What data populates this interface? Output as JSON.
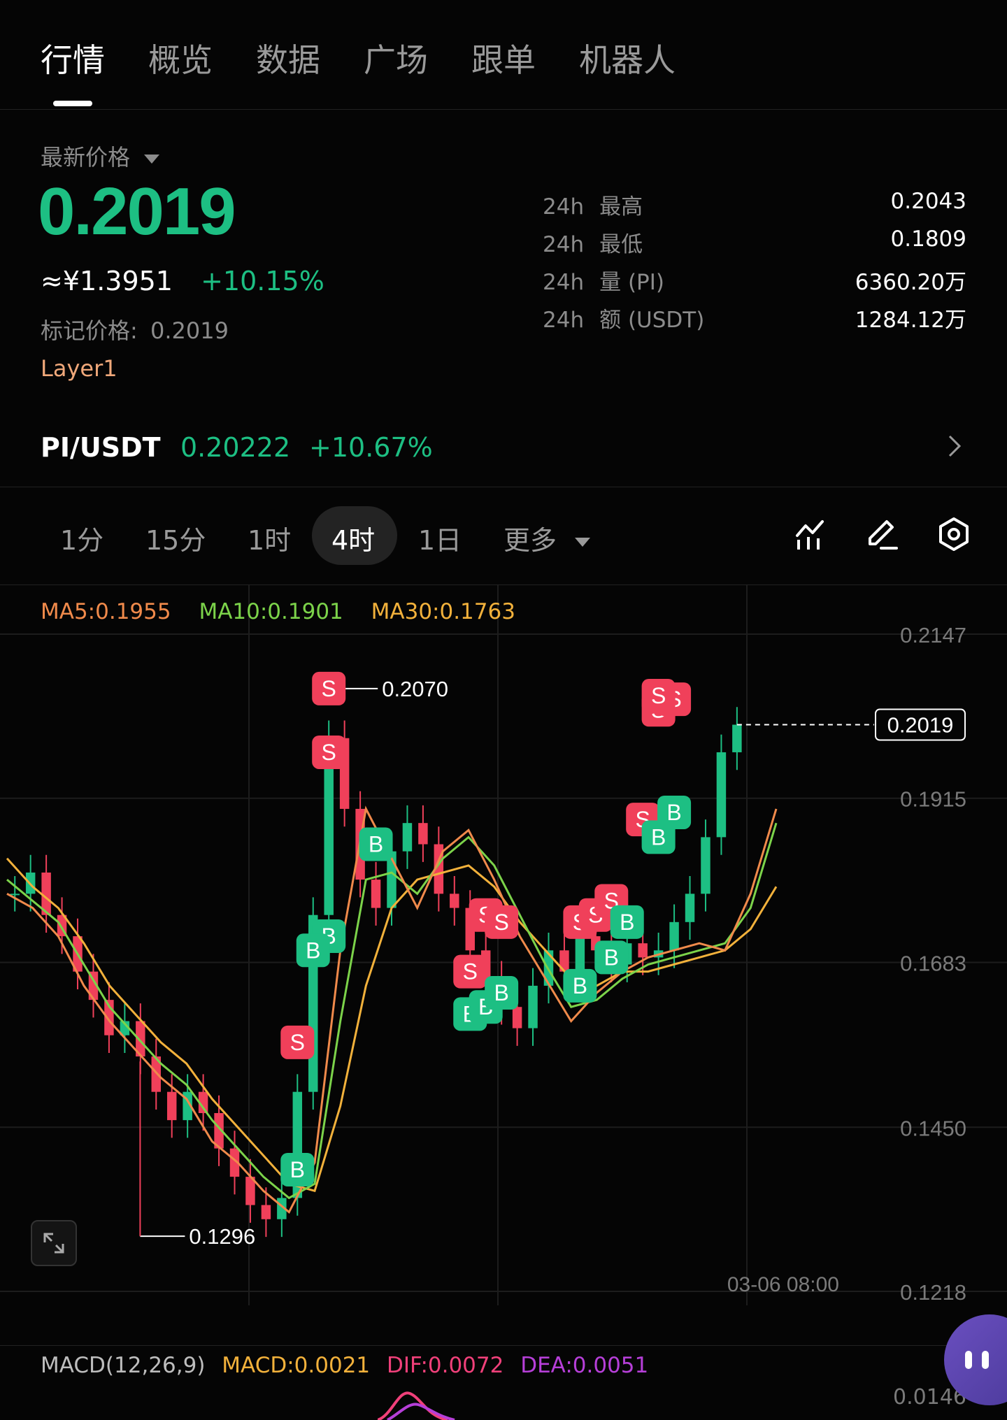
{
  "tabs": [
    {
      "label": "行情",
      "active": true
    },
    {
      "label": "概览"
    },
    {
      "label": "数据"
    },
    {
      "label": "广场"
    },
    {
      "label": "跟单"
    },
    {
      "label": "机器人"
    }
  ],
  "price": {
    "selector_label": "最新价格",
    "last": "0.2019",
    "cny": "≈¥1.3951",
    "change": "+10.15%",
    "mark_label": "标记价格:",
    "mark_value": "0.2019",
    "tag": "Layer1",
    "colors": {
      "up": "#1dbf83",
      "tag": "#f0a87a"
    }
  },
  "stats": [
    {
      "period": "24h",
      "label": "最高",
      "value": "0.2043"
    },
    {
      "period": "24h",
      "label": "最低",
      "value": "0.1809"
    },
    {
      "period": "24h",
      "label": "量 (PI)",
      "value": "6360.20万"
    },
    {
      "period": "24h",
      "label": "额 (USDT)",
      "value": "1284.12万"
    }
  ],
  "pair": {
    "name": "PI/USDT",
    "price": "0.20222",
    "change": "+10.67%"
  },
  "timeframes": {
    "items": [
      "1分",
      "15分",
      "1时",
      "4时",
      "1日"
    ],
    "more": "更多",
    "active": "4时"
  },
  "toolbar_icons": [
    "indicator-icon",
    "pen-icon",
    "settings-icon"
  ],
  "indicators": {
    "ma5": "MA5:0.1955",
    "ma10": "MA10:0.1901",
    "ma30": "MA30:0.1763",
    "colors": {
      "ma5": "#f08a4b",
      "ma10": "#7cd34a",
      "ma30": "#f2b13b"
    }
  },
  "chart_data": {
    "type": "candlestick",
    "y_ticks": [
      "0.2147",
      "0.1915",
      "0.1683",
      "0.1450",
      "0.1218"
    ],
    "ylim": [
      0.1218,
      0.2147
    ],
    "high_label": "0.2070",
    "low_label": "0.1296",
    "current_price_label": "0.2019",
    "x_label": "03-06 08:00",
    "ma5": [
      0.178,
      0.176,
      0.172,
      0.165,
      0.16,
      0.156,
      0.152,
      0.149,
      0.143,
      0.14,
      0.136,
      0.133,
      0.14,
      0.17,
      0.19,
      0.183,
      0.176,
      0.184,
      0.187,
      0.18,
      0.172,
      0.166,
      0.16,
      0.164,
      0.167,
      0.169,
      0.17,
      0.171,
      0.17,
      0.178,
      0.19
    ],
    "ma10": [
      0.18,
      0.177,
      0.174,
      0.168,
      0.162,
      0.158,
      0.154,
      0.151,
      0.146,
      0.142,
      0.138,
      0.135,
      0.137,
      0.16,
      0.18,
      0.181,
      0.178,
      0.183,
      0.186,
      0.182,
      0.175,
      0.168,
      0.162,
      0.163,
      0.166,
      0.168,
      0.169,
      0.17,
      0.171,
      0.176,
      0.188
    ],
    "ma30": [
      0.183,
      0.179,
      0.176,
      0.171,
      0.165,
      0.161,
      0.157,
      0.154,
      0.149,
      0.145,
      0.141,
      0.137,
      0.136,
      0.148,
      0.165,
      0.176,
      0.18,
      0.181,
      0.182,
      0.179,
      0.174,
      0.17,
      0.166,
      0.165,
      0.167,
      0.167,
      0.168,
      0.169,
      0.17,
      0.173,
      0.179
    ],
    "closes": [
      0.178,
      0.181,
      0.175,
      0.172,
      0.167,
      0.163,
      0.158,
      0.16,
      0.155,
      0.15,
      0.146,
      0.15,
      0.147,
      0.142,
      0.138,
      0.134,
      0.132,
      0.135,
      0.15,
      0.175,
      0.2,
      0.19,
      0.18,
      0.176,
      0.184,
      0.188,
      0.185,
      0.178,
      0.176,
      0.17,
      0.166,
      0.162,
      0.159,
      0.165,
      0.17,
      0.167,
      0.172,
      0.17,
      0.168,
      0.171,
      0.169,
      0.17,
      0.174,
      0.178,
      0.186,
      0.198,
      0.2019
    ],
    "markers": [
      {
        "type": "S",
        "price": 0.207,
        "index": 20
      },
      {
        "type": "S",
        "price": 0.198,
        "index": 20
      },
      {
        "type": "S",
        "price": 0.157,
        "index": 18
      },
      {
        "type": "B",
        "price": 0.172,
        "index": 20
      },
      {
        "type": "B",
        "price": 0.17,
        "index": 19
      },
      {
        "type": "B",
        "price": 0.139,
        "index": 18
      },
      {
        "type": "B",
        "price": 0.185,
        "index": 23
      },
      {
        "type": "S",
        "price": 0.175,
        "index": 30
      },
      {
        "type": "S",
        "price": 0.174,
        "index": 31
      },
      {
        "type": "S",
        "price": 0.167,
        "index": 29
      },
      {
        "type": "B",
        "price": 0.161,
        "index": 29
      },
      {
        "type": "B",
        "price": 0.162,
        "index": 30
      },
      {
        "type": "B",
        "price": 0.164,
        "index": 31
      },
      {
        "type": "S",
        "price": 0.174,
        "index": 36
      },
      {
        "type": "S",
        "price": 0.175,
        "index": 37
      },
      {
        "type": "S",
        "price": 0.177,
        "index": 38
      },
      {
        "type": "B",
        "price": 0.165,
        "index": 36
      },
      {
        "type": "B",
        "price": 0.169,
        "index": 38
      },
      {
        "type": "B",
        "price": 0.174,
        "index": 39
      },
      {
        "type": "S",
        "price": 0.1885,
        "index": 40
      },
      {
        "type": "B",
        "price": 0.186,
        "index": 41
      },
      {
        "type": "B",
        "price": 0.1895,
        "index": 42
      },
      {
        "type": "S",
        "price": 0.204,
        "index": 41
      },
      {
        "type": "S",
        "price": 0.2055,
        "index": 42
      },
      {
        "type": "S",
        "price": 0.206,
        "index": 41
      }
    ]
  },
  "macd": {
    "label": "MACD(12,26,9)",
    "macd": "MACD:0.0021",
    "dif": "DIF:0.0072",
    "dea": "DEA:0.0051",
    "axis_top": "0.0146",
    "colors": {
      "label": "#bdbdbd",
      "macd": "#f2b13b",
      "dif": "#f0407a",
      "dea": "#b63fd8"
    }
  }
}
